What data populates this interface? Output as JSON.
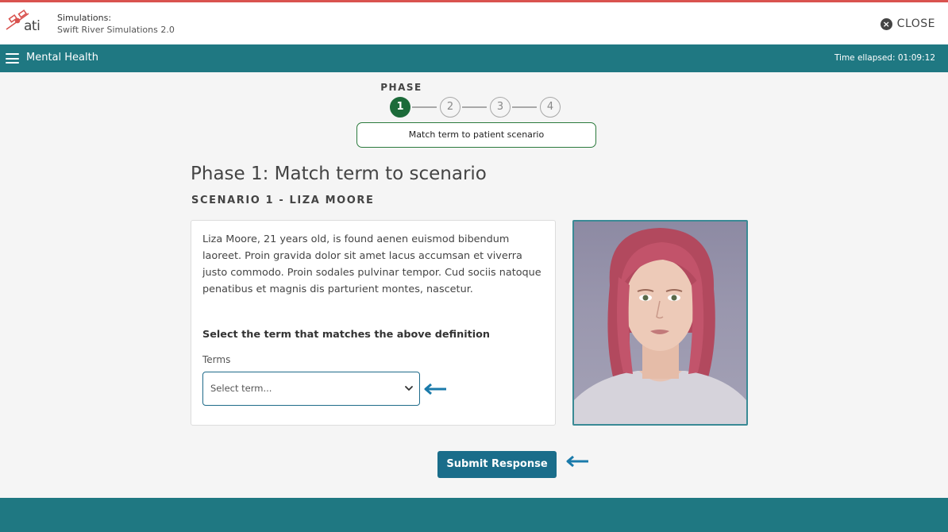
{
  "header": {
    "logo_text": "ati",
    "app_title_line1": "Simulations:",
    "app_title_line2": "Swift River Simulations 2.0",
    "close_label": "CLOSE",
    "close_icon": "close-circle-icon"
  },
  "nav": {
    "menu_icon": "hamburger-menu-icon",
    "title": "Mental Health",
    "time_elapsed": "Time ellapsed: 01:09:12"
  },
  "phase": {
    "label": "PHASE",
    "steps": [
      "1",
      "2",
      "3",
      "4"
    ],
    "active_step": 1,
    "description": "Match term to patient scenario"
  },
  "main": {
    "heading": "Phase 1: Match term to scenario",
    "scenario_title": "SCENARIO 1 -  LIZA MOORE",
    "description": "Liza Moore, 21 years old, is found aenen euismod bibendum laoreet. Proin gravida dolor sit amet lacus accumsan et viverra justo commodo. Proin sodales pulvinar tempor. Cud sociis natoque penatibus et magnis dis parturient montes, nascetur.",
    "instruction": "Select the term that matches the above definition",
    "terms_label": "Terms",
    "select_placeholder": "Select term...",
    "submit_label": "Submit Response"
  },
  "colors": {
    "teal": "#1f7882",
    "active_step": "#1c6b3a",
    "pill_border": "#2b7a3c",
    "button": "#1a6d8a",
    "arrow": "#1a7aaa",
    "top_accent": "#d9534f"
  }
}
